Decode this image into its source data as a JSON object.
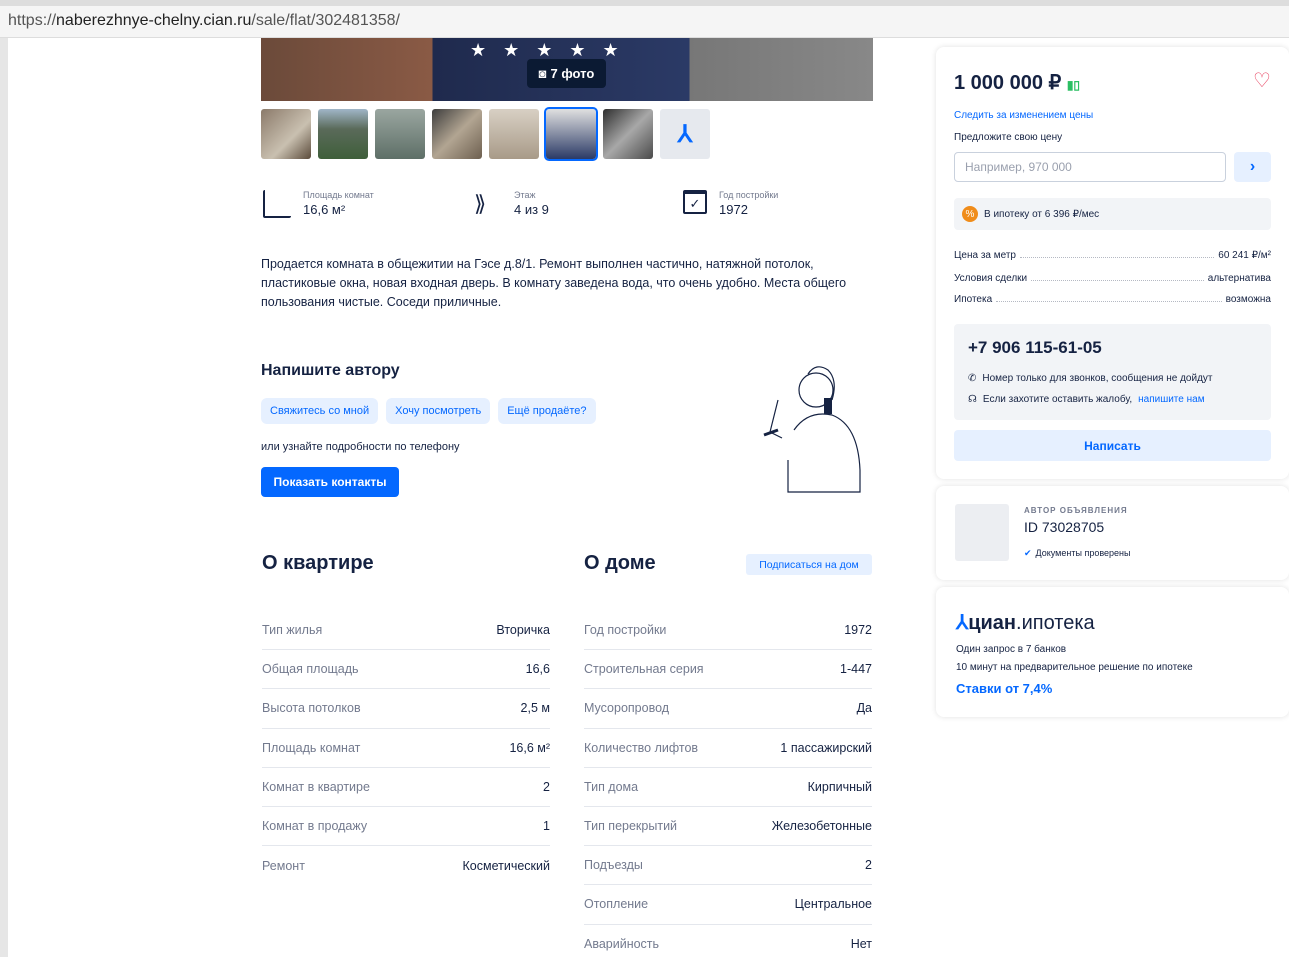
{
  "browser": {
    "url_prefix": "https://",
    "url_host": "naberezhnye-chelny.cian.ru",
    "url_path": "/sale/flat/302481358/"
  },
  "gallery": {
    "photo_count": "7 фото",
    "camera_icon": "camera-icon",
    "map_icon": "cian-logo-icon"
  },
  "features": [
    {
      "label": "Площадь комнат",
      "value": "16,6 м²",
      "icon": "area-icon"
    },
    {
      "label": "Этаж",
      "value": "4 из 9",
      "icon": "stairs-icon"
    },
    {
      "label": "Год постройки",
      "value": "1972",
      "icon": "calendar-icon"
    }
  ],
  "description": "Продается комната в общежитии на Гэсе д.8/1. Ремонт выполнен частично, натяжной потолок, пластиковые окна, новая входная дверь. В комнату заведена вода, что очень удобно. Места общего пользования чистые. Соседи приличные.",
  "write_author": {
    "title": "Напишите автору",
    "chips": [
      "Свяжитесь со мной",
      "Хочу посмотреть",
      "Ещё продаёте?"
    ],
    "or_phone": "или узнайте подробности по телефону",
    "show_contacts": "Показать контакты"
  },
  "about_flat": {
    "title": "О квартире",
    "rows": [
      {
        "k": "Тип жилья",
        "v": "Вторичка"
      },
      {
        "k": "Общая площадь",
        "v": "16,6"
      },
      {
        "k": "Высота потолков",
        "v": "2,5 м"
      },
      {
        "k": "Площадь комнат",
        "v": "16,6 м²"
      },
      {
        "k": "Комнат в квартире",
        "v": "2"
      },
      {
        "k": "Комнат в продажу",
        "v": "1"
      },
      {
        "k": "Ремонт",
        "v": "Косметический"
      }
    ]
  },
  "about_house": {
    "title": "О доме",
    "subscribe": "Подписаться на дом",
    "rows": [
      {
        "k": "Год постройки",
        "v": "1972"
      },
      {
        "k": "Строительная серия",
        "v": "1-447"
      },
      {
        "k": "Мусоропровод",
        "v": "Да"
      },
      {
        "k": "Количество лифтов",
        "v": "1 пассажирский"
      },
      {
        "k": "Тип дома",
        "v": "Кирпичный"
      },
      {
        "k": "Тип перекрытий",
        "v": "Железобетонные"
      },
      {
        "k": "Подъезды",
        "v": "2"
      },
      {
        "k": "Отопление",
        "v": "Центральное"
      },
      {
        "k": "Аварийность",
        "v": "Нет"
      }
    ]
  },
  "sidebar": {
    "price": "1 000 000 ₽",
    "watch_price": "Следить за изменением цены",
    "offer_label": "Предложите свою цену",
    "offer_placeholder": "Например, 970 000",
    "mortgage_text": "В ипотеку от 6 396 ₽/мес",
    "params": [
      {
        "k": "Цена за метр",
        "v": "60 241 ₽/м²"
      },
      {
        "k": "Условия сделки",
        "v": "альтернатива"
      },
      {
        "k": "Ипотека",
        "v": "возможна"
      }
    ],
    "phone": "+7 906 115-61-05",
    "calls_only": "Номер только для звонков, сообщения не дойдут",
    "complaint": "Если захотите оставить жалобу,",
    "complaint_link": "напишите нам",
    "write_button": "Написать",
    "author_label": "АВТОР ОБЪЯВЛЕНИЯ",
    "author_id": "ID 73028705",
    "docs_checked": "Документы проверены",
    "brand_main": "циан",
    "brand_rest": ".ипотека",
    "promo1": "Один запрос в 7 банков",
    "promo2": "10 минут на предварительное решение по ипотеке",
    "rates": "Ставки от 7,4%"
  },
  "colors": {
    "accent": "#0468ff",
    "heart": "#e84260",
    "text": "#152242"
  }
}
